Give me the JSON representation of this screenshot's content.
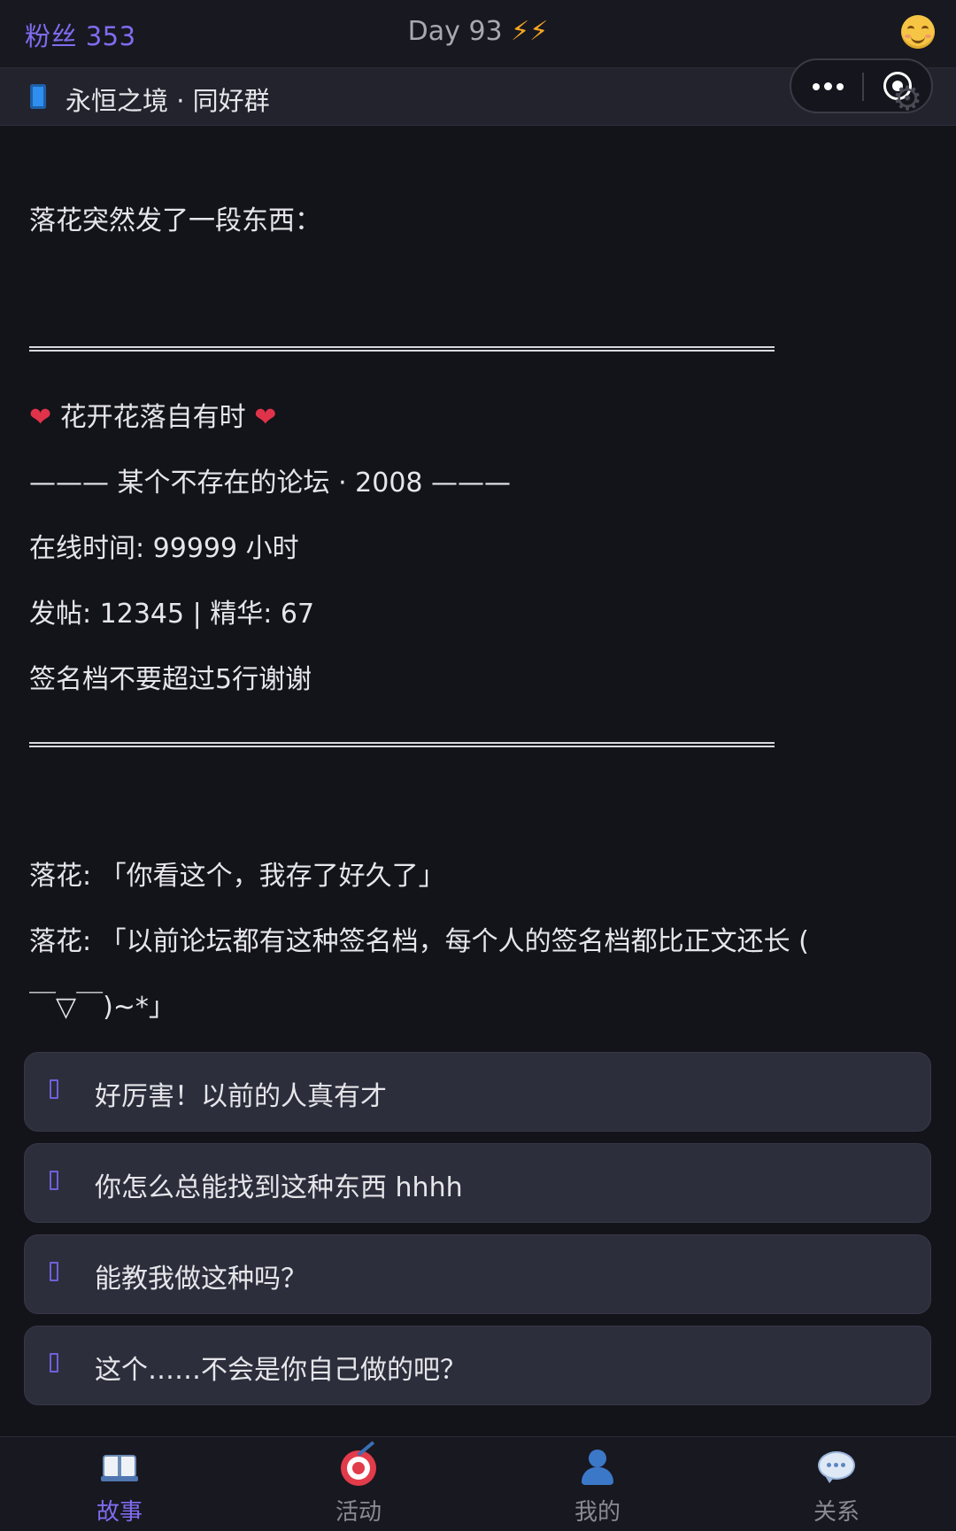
{
  "status_bar": {
    "fans_label": "粉丝 353",
    "day_label": "Day 93",
    "day_bolts": "⚡⚡",
    "mood_icon": "smiling-face-icon"
  },
  "header": {
    "icon": "mobile-phone-icon",
    "title": "永恒之境 · 同好群"
  },
  "story": {
    "intro": "落花突然发了一段东西：",
    "signature": {
      "heart_left": "❤",
      "title": "花开花落自有时",
      "heart_right": "❤",
      "forum_line": "——— 某个不存在的论坛 · 2008 ———",
      "online_line": "在线时间: 99999 小时",
      "posts_line": "发帖: 12345 | 精华: 67",
      "note_line": "签名档不要超过5行谢谢"
    },
    "dialogue": [
      "落花: 「你看这个，我存了好久了」",
      "落花: 「以前论坛都有这种签名档，每个人的签名档都比正文还长 (",
      "￣▽￣)~*」"
    ]
  },
  "choices": [
    {
      "label": "好厉害！以前的人真有才"
    },
    {
      "label": "你怎么总能找到这种东西 hhhh"
    },
    {
      "label": "能教我做这种吗？"
    },
    {
      "label": "这个……不会是你自己做的吧？"
    }
  ],
  "bottom_nav": {
    "items": [
      {
        "label": "故事",
        "icon": "open-book-icon",
        "active": true
      },
      {
        "label": "活动",
        "icon": "target-dart-icon",
        "active": false
      },
      {
        "label": "我的",
        "icon": "person-icon",
        "active": false
      },
      {
        "label": "关系",
        "icon": "speech-bubble-icon",
        "active": false
      }
    ]
  },
  "colors": {
    "accent": "#7f6cf0",
    "background": "#13131a",
    "choice_bg": "#2c2e3c",
    "heart": "#e0334a",
    "bolt": "#f5a623"
  }
}
